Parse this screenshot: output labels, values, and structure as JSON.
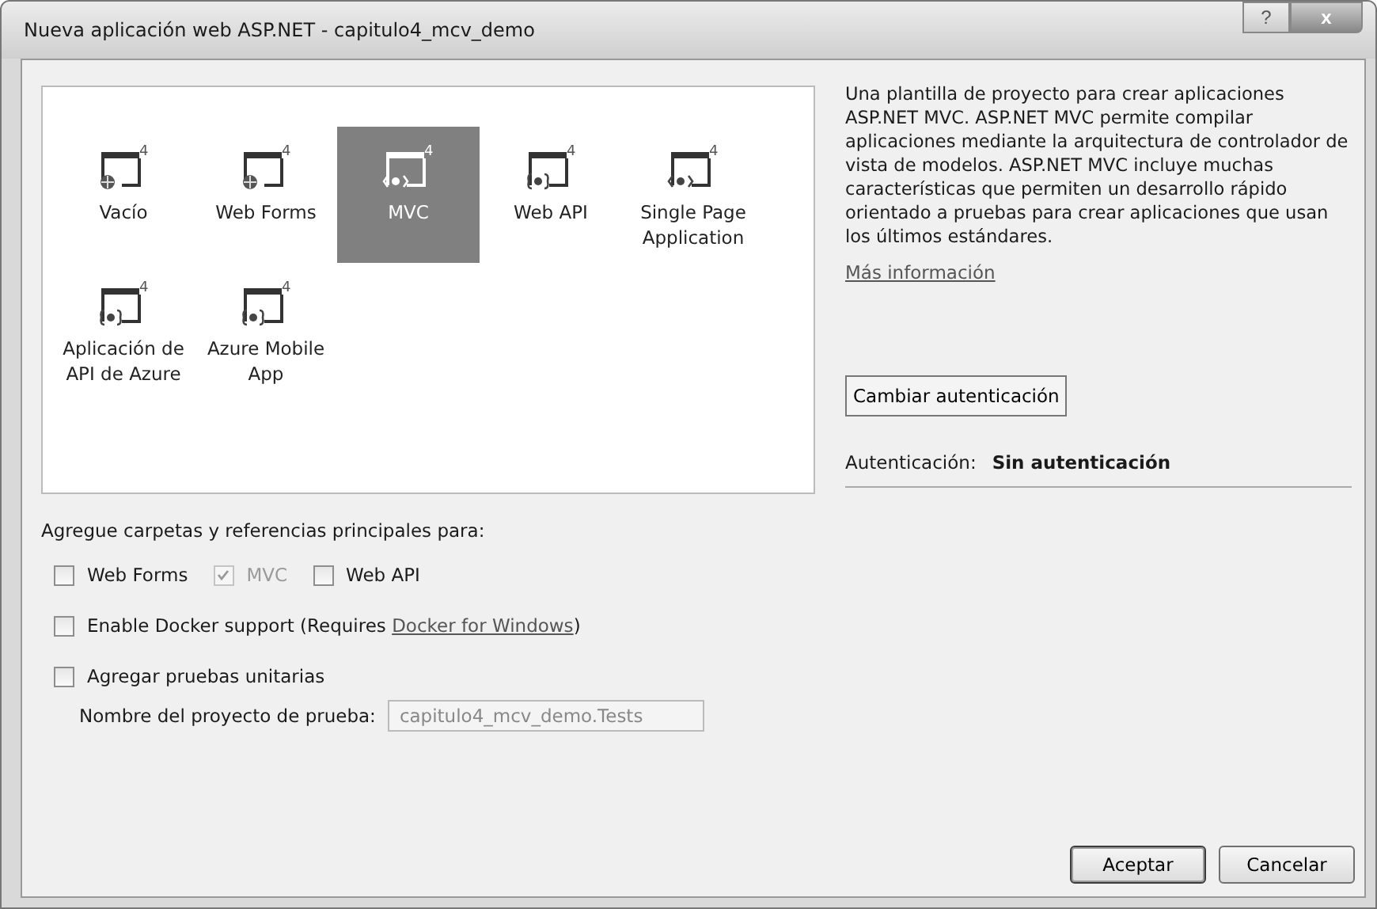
{
  "window": {
    "title": "Nueva aplicación web ASP.NET - capitulo4_mcv_demo",
    "help": "?",
    "close": "x"
  },
  "templates": [
    {
      "label": "Vacío",
      "kind": "globe",
      "badge": "4",
      "selected": false
    },
    {
      "label": "Web Forms",
      "kind": "globe",
      "badge": "4",
      "selected": false
    },
    {
      "label": "MVC",
      "kind": "angle",
      "badge": "4",
      "selected": true
    },
    {
      "label": "Web API",
      "kind": "brace",
      "badge": "4",
      "selected": false
    },
    {
      "label": "Single Page Application",
      "kind": "angle",
      "badge": "4",
      "selected": false
    },
    {
      "label": "Aplicación de API de Azure",
      "kind": "brace",
      "badge": "4",
      "selected": false
    },
    {
      "label": "Azure Mobile App",
      "kind": "brace",
      "badge": "4",
      "selected": false
    }
  ],
  "description": "Una plantilla de proyecto para crear aplicaciones ASP.NET MVC. ASP.NET MVC permite compilar aplicaciones mediante la arquitectura de controlador de vista de modelos. ASP.NET MVC incluye muchas características que permiten un desarrollo rápido orientado a pruebas para crear aplicaciones que usan los últimos estándares.",
  "more_info_link": "Más información",
  "change_auth_button": "Cambiar autenticación",
  "auth": {
    "label": "Autenticación:",
    "value": "Sin autenticación"
  },
  "folders_heading": "Agregue carpetas y referencias principales para:",
  "folder_options": [
    {
      "label": "Web Forms",
      "checked": false,
      "disabled": false
    },
    {
      "label": "MVC",
      "checked": true,
      "disabled": true
    },
    {
      "label": "Web API",
      "checked": false,
      "disabled": false
    }
  ],
  "docker": {
    "checked": false,
    "text": "Enable Docker support (Requires ",
    "link": "Docker for Windows",
    "after": ")"
  },
  "unit_tests": {
    "checked": false,
    "label": "Agregar pruebas unitarias",
    "name_label": "Nombre del proyecto de prueba:",
    "name_value": "capitulo4_mcv_demo.Tests"
  },
  "buttons": [
    {
      "label": "Aceptar",
      "default": true
    },
    {
      "label": "Cancelar",
      "default": false
    }
  ]
}
